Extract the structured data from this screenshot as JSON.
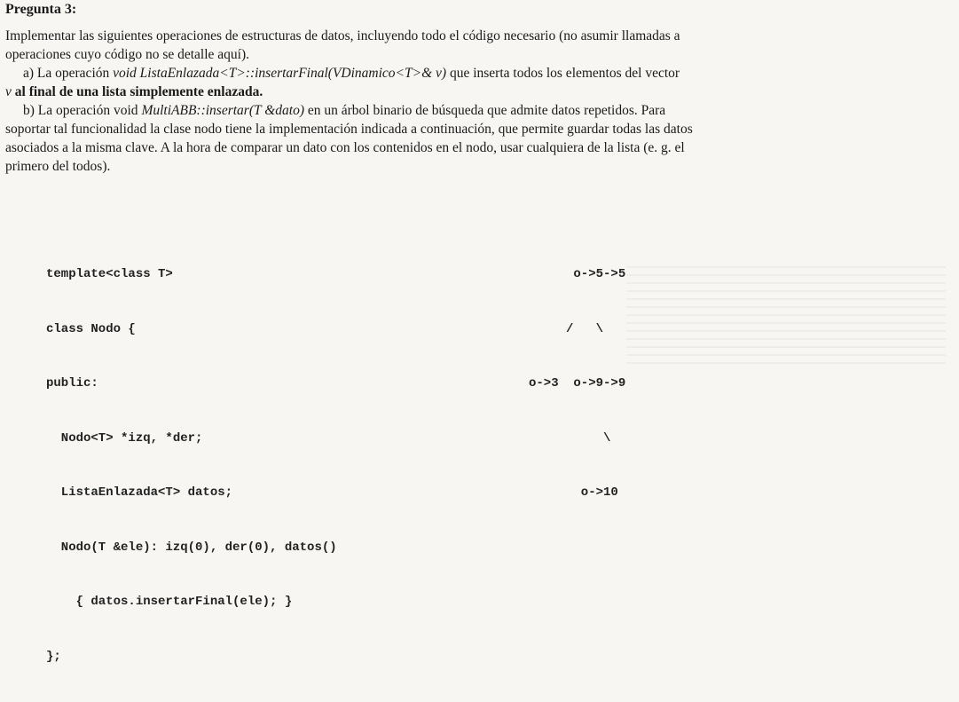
{
  "heading": "Pregunta 3:",
  "intro": {
    "line1": "Implementar las siguientes operaciones de estructuras de datos, incluyendo todo el código necesario (no asumir llamadas a",
    "line2": "operaciones cuyo código no se detalle aquí)."
  },
  "item_a": {
    "prefix": "a) La operación ",
    "signature": "void ListaEnlazada<T>::insertarFinal(VDinamico<T>& v)",
    "suffix": " que inserta todos los elementos del vector",
    "line2_var": "v",
    "line2_rest": " al final de una lista simplemente enlazada."
  },
  "item_b": {
    "prefix": "b) La operación void ",
    "signature": "MultiABB::insertar(T &dato)",
    "suffix": " en un árbol binario de búsqueda que admite datos repetidos. Para",
    "line2": "soportar tal funcionalidad la clase nodo tiene la implementación indicada a continuación, que permite guardar todas las datos",
    "line3": "asociados a la misma clave. A la hora de comparar un dato con los contenidos en el nodo, usar cualquiera de la lista (e. g. el",
    "line4": "primero del todos)."
  },
  "code_lines": [
    "template<class T>",
    "class Nodo {",
    "public:",
    "  Nodo<T> *izq, *der;",
    "  ListaEnlazada<T> datos;",
    "  Nodo(T &ele): izq(0), der(0), datos()",
    "    { datos.insertarFinal(ele); }",
    "};"
  ],
  "tree_lines": [
    "      o->5->5",
    "     /   \\",
    "o->3  o->9->9",
    "          \\",
    "       o->10"
  ]
}
